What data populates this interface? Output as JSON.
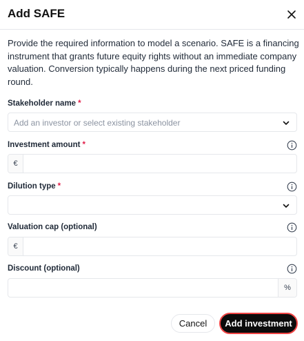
{
  "dialog": {
    "title": "Add SAFE",
    "description": "Provide the required information to model a scenario. SAFE is a financing instrument that grants future equity rights without an immediate company valuation. Conversion typically happens during the next priced funding round."
  },
  "fields": {
    "stakeholder": {
      "label": "Stakeholder name",
      "required_mark": "*",
      "placeholder": "Add an investor or select existing stakeholder"
    },
    "investment": {
      "label": "Investment amount",
      "required_mark": "*",
      "prefix": "€",
      "value": ""
    },
    "dilution": {
      "label": "Dilution type",
      "required_mark": "*",
      "selected": ""
    },
    "valuation_cap": {
      "label": "Valuation cap (optional)",
      "prefix": "€",
      "value": ""
    },
    "discount": {
      "label": "Discount (optional)",
      "suffix": "%",
      "value": ""
    }
  },
  "actions": {
    "cancel_label": "Cancel",
    "submit_label": "Add investment"
  },
  "colors": {
    "required": "#e11d48",
    "primary_button": "#0b0b0b",
    "focus_ring": "#ef4444",
    "border": "#e5e7eb"
  },
  "icons": {
    "close": "close-icon",
    "info": "info-icon",
    "chevron": "chevron-down-icon"
  }
}
